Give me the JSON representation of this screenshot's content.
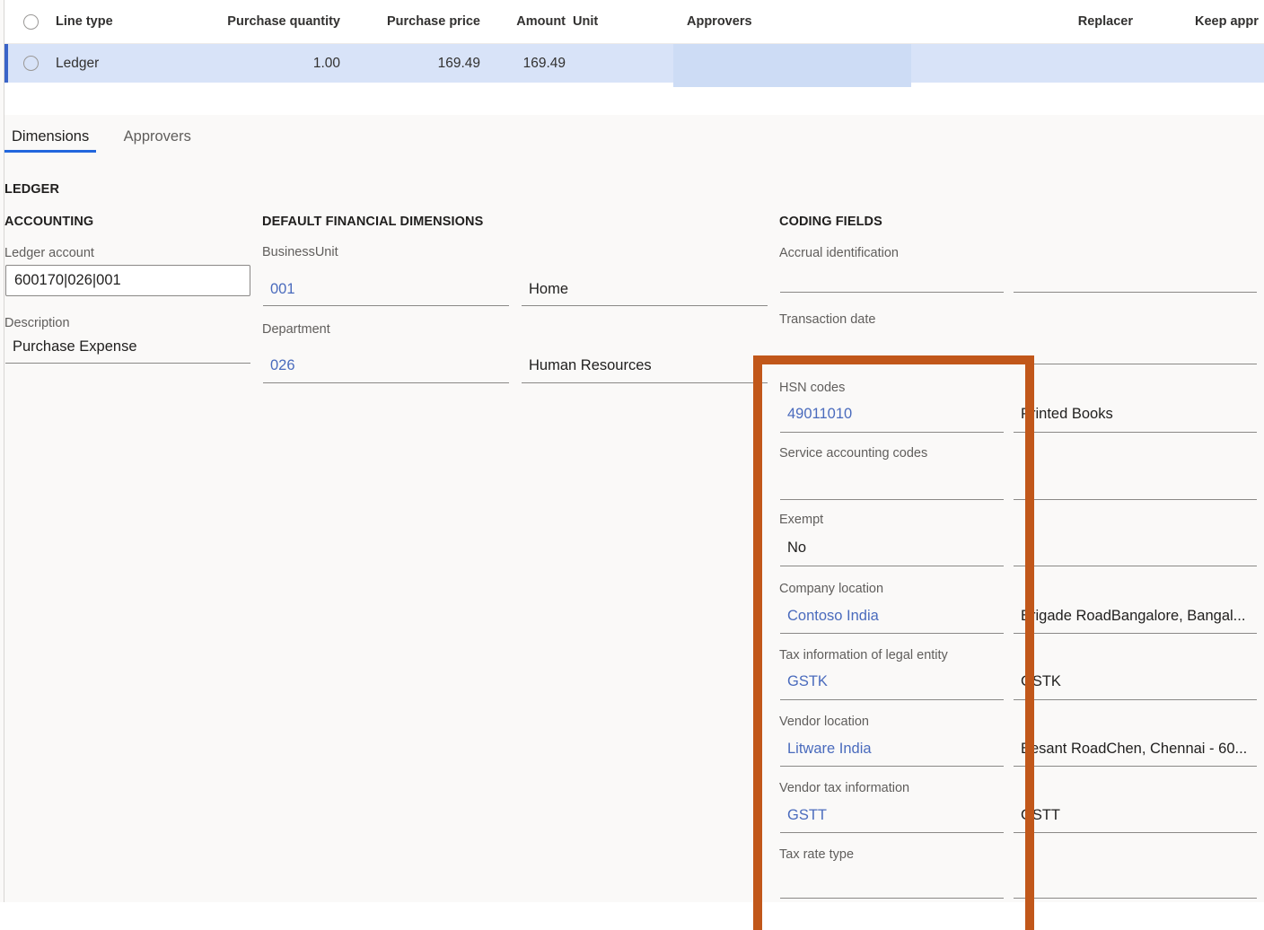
{
  "grid": {
    "columns": [
      {
        "label": "Line type",
        "align": "left"
      },
      {
        "label": "Purchase quantity",
        "align": "right"
      },
      {
        "label": "Purchase price",
        "align": "right"
      },
      {
        "label": "Amount",
        "align": "right"
      },
      {
        "label": "Unit",
        "align": "left"
      },
      {
        "label": "Approvers",
        "align": "left"
      },
      {
        "label": "Replacer",
        "align": "right"
      },
      {
        "label": "Keep appr",
        "align": "left"
      }
    ],
    "rows": [
      {
        "line_type": "Ledger",
        "purchase_quantity": "1.00",
        "purchase_price": "169.49",
        "amount": "169.49",
        "unit": "",
        "approvers": "",
        "replacer": "",
        "keep_approver": ""
      }
    ]
  },
  "tabs": [
    {
      "label": "Dimensions",
      "active": true
    },
    {
      "label": "Approvers",
      "active": false
    }
  ],
  "detail": {
    "record_caption": "LEDGER",
    "accounting": {
      "caption": "ACCOUNTING",
      "ledger_account": {
        "label": "Ledger account",
        "value": "600170|026|001"
      },
      "description": {
        "label": "Description",
        "value": "Purchase Expense"
      }
    },
    "default_financial_dimensions": {
      "caption": "DEFAULT FINANCIAL DIMENSIONS",
      "rows": [
        {
          "label": "BusinessUnit",
          "code": "001",
          "name": "Home"
        },
        {
          "label": "Department",
          "code": "026",
          "name": "Human Resources"
        }
      ]
    },
    "coding_fields": {
      "caption": "CODING FIELDS",
      "rows": [
        {
          "label": "Accrual identification",
          "value": "",
          "secondary": ""
        },
        {
          "label": "Transaction date",
          "value": "",
          "secondary": ""
        },
        {
          "label": "HSN codes",
          "value": "49011010",
          "secondary": "Printed Books"
        },
        {
          "label": "Service accounting codes",
          "value": "",
          "secondary": ""
        },
        {
          "label": "Exempt",
          "value": "No",
          "secondary": ""
        },
        {
          "label": "Company location",
          "value": "Contoso India",
          "secondary": "Brigade RoadBangalore, Bangal..."
        },
        {
          "label": "Tax information of legal entity",
          "value": "GSTK",
          "secondary": "GSTK"
        },
        {
          "label": "Vendor location",
          "value": "Litware India",
          "secondary": "Besant RoadChen, Chennai - 60..."
        },
        {
          "label": "Vendor tax information",
          "value": "GSTT",
          "secondary": "GSTT"
        },
        {
          "label": "Tax rate type",
          "value": "",
          "secondary": ""
        }
      ]
    }
  },
  "annotation": {
    "highlight_color": "#c1571a",
    "shape": "rectangle-outline"
  },
  "colors": {
    "selected_row": "#d8e3f8",
    "row_accent": "#3a64c8",
    "link_text": "#4a6bbd",
    "tab_underline": "#2266dd",
    "page_background": "#faf9f8"
  }
}
